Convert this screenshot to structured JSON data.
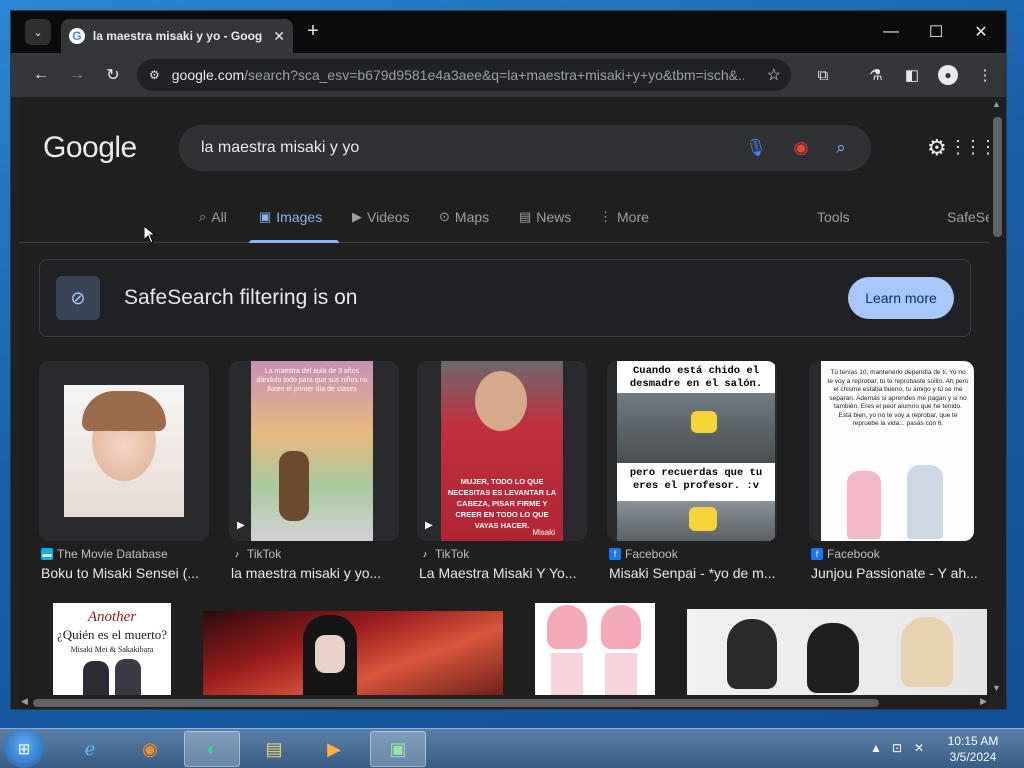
{
  "browser": {
    "tab_title": "la maestra misaki y yo - Google",
    "tab_close": "✕",
    "new_tab": "+",
    "url_host": "google.com",
    "url_rest": "/search?sca_esv=b679d9581e4a3aee&q=la+maestra+misaki+y+yo&tbm=isch&...",
    "window_controls": [
      "—",
      "☐",
      "✕"
    ]
  },
  "google": {
    "logo": "Google",
    "query": "la maestra misaki y yo",
    "tabs": [
      {
        "label": "All",
        "icon": "search-icon"
      },
      {
        "label": "Images",
        "icon": "image-icon"
      },
      {
        "label": "Videos",
        "icon": "video-icon"
      },
      {
        "label": "Maps",
        "icon": "map-pin-icon"
      },
      {
        "label": "News",
        "icon": "news-icon"
      },
      {
        "label": "More",
        "icon": "more-vertical-icon"
      }
    ],
    "tools": "Tools",
    "safesearch_tab": "SafeSe",
    "banner": {
      "text": "SafeSearch filtering is on",
      "button": "Learn more"
    },
    "results": [
      {
        "source": "The Movie Database",
        "caption": "Boku to Misaki Sensei (..."
      },
      {
        "source": "TikTok",
        "caption": "la maestra misaki y yo..."
      },
      {
        "source": "TikTok",
        "caption": "La Maestra Misaki Y Yo..."
      },
      {
        "source": "Facebook",
        "caption": "Misaki Senpai - *yo de m..."
      },
      {
        "source": "Facebook",
        "caption": "Junjou Passionate - Y ah..."
      }
    ],
    "thumb_text": {
      "t2": "La maestra del aula de 3 años dándolo todo para que sus niños no lloren el primer día de clases",
      "t3": "MUJER, TODO LO QUE NECESITAS ES LEVANTAR LA CABEZA, PISAR FIRME Y CREER EN TODO LO QUE VAYAS HACER.",
      "t3_sig": "Misaki",
      "t4_top": "Cuando está chido el desmadre en el salón.",
      "t4_bottom": "pero recuerdas que tu eres el profesor. :v",
      "t5": "Tú tenías 10, mantenerlo dependía de ti. Yo no te voy a reprobar, tú te reprobaste solito. Ah pero el chisme estaba bueno, tu amigo y tú se me separan. Además si aprendes me pagan y si no también. Eres el peor alumno que he tenido. Está bien, yo no te voy a reprobar, que te repruebe la vida... pasas con 6.",
      "r2_1_title": "Another",
      "r2_1_sub": "¿Quién es el muerto?",
      "r2_1_names": "Misaki Mei & Sakakibara"
    }
  },
  "taskbar": {
    "time": "10:15 AM",
    "date": "3/5/2024"
  },
  "colors": {
    "accent": "#8ab4f8",
    "button_bg": "#a8c7fa",
    "page_bg": "#1f1f1f"
  }
}
